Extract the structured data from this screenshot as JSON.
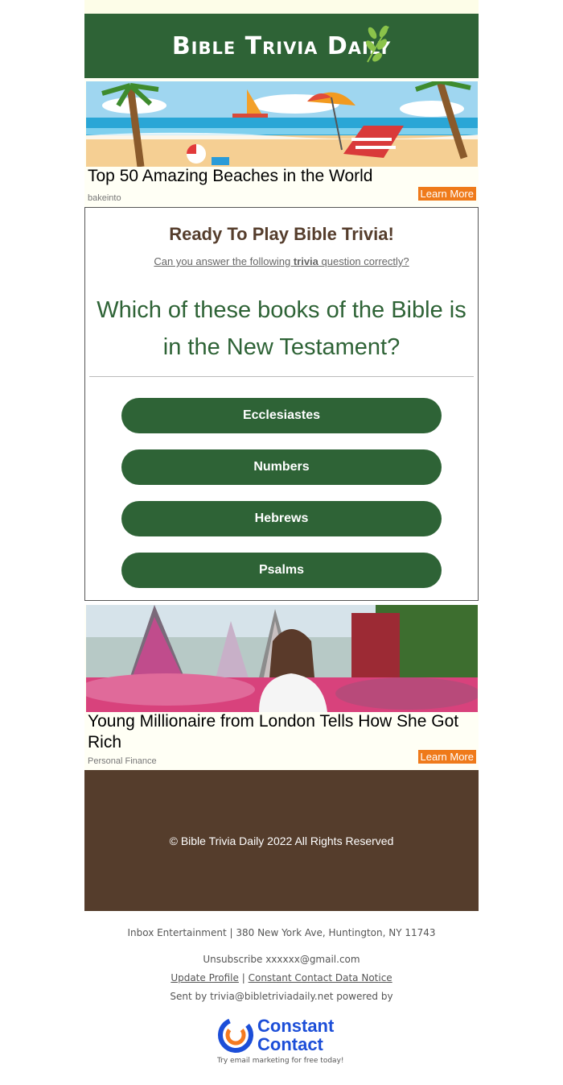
{
  "header": {
    "logo_text": "Bible Trivia Daily"
  },
  "ad_top": {
    "title": "Top 50 Amazing Beaches in the World",
    "source": "bakeinto",
    "cta": "Learn More",
    "image": "beach-illustration"
  },
  "quiz": {
    "heading": "Ready To Play Bible Trivia!",
    "sub_before": "Can you answer the following ",
    "sub_bold": "trivia",
    "sub_after": " question correctly?",
    "question": "Which of these books of the Bible is in the New Testament?",
    "answers": [
      "Ecclesiastes",
      "Numbers",
      "Hebrews",
      "Psalms"
    ]
  },
  "ad_bottom": {
    "title": "Young Millionaire from London Tells How She Got Rich",
    "source": "Personal Finance",
    "cta": "Learn More",
    "image": "woman-in-flower-garden-photo"
  },
  "footer": {
    "copyright": "© Bible Trivia Daily 2022 All Rights Reserved",
    "address": "Inbox Entertainment | 380 New York Ave, Huntington, NY 11743",
    "unsubscribe_label": "Unsubscribe",
    "unsubscribe_email": "xxxxxx@gmail.com",
    "update_profile": "Update Profile",
    "separator": "|",
    "data_notice": "Constant Contact Data Notice",
    "sent_by": "Sent by trivia@bibletriviadaily.net powered by",
    "cc_brand_line1": "Constant",
    "cc_brand_line2": "Contact",
    "cc_tagline": "Try email marketing for free today!"
  },
  "colors": {
    "green": "#2e6336",
    "brown": "#553d2c",
    "orange": "#ef7a1a",
    "cc_blue": "#1c4ed8"
  }
}
